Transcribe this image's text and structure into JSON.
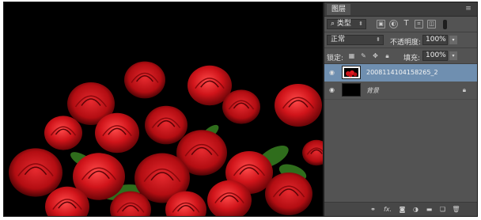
{
  "panel": {
    "tab_title": "图层",
    "menu_icon": "panel-menu-icon",
    "filter": {
      "kind_label": "类型",
      "icons": [
        "image-filter-icon",
        "adjustment-filter-icon",
        "type-filter-icon",
        "shape-filter-icon",
        "smart-object-filter-icon"
      ]
    },
    "blend_mode": "正常",
    "opacity_label": "不透明度:",
    "opacity_value": "100%",
    "lock_label": "锁定:",
    "lock_icons": [
      "lock-transparent-icon",
      "lock-pixels-icon",
      "lock-position-icon",
      "lock-all-icon"
    ],
    "fill_label": "填充:",
    "fill_value": "100%",
    "layers": [
      {
        "name": "2008114104158265_2",
        "selected": true,
        "visible": true,
        "locked": false,
        "italic": false
      },
      {
        "name": "背景",
        "selected": false,
        "visible": true,
        "locked": true,
        "italic": true
      }
    ],
    "bottom_icons": [
      "link-layers-icon",
      "fx-icon",
      "add-mask-icon",
      "adjustment-layer-icon",
      "new-group-icon",
      "new-layer-icon",
      "delete-layer-icon"
    ],
    "bottom_fx_text": "fx."
  },
  "colors": {
    "panel_bg": "#535353",
    "selected_layer": "#6f8fb0",
    "canvas_bg": "#000000",
    "rose_red": "#d0141a"
  }
}
